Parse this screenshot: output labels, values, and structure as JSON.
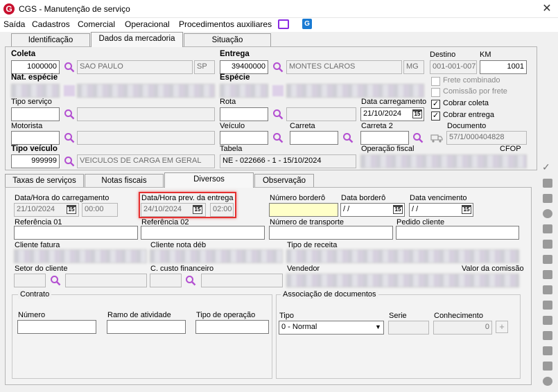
{
  "window": {
    "title": "CGS - Manutenção de serviço",
    "logo_letter": "G",
    "close": "✕"
  },
  "menu": [
    "Saída",
    "Cadastros",
    "Comercial",
    "Operacional",
    "Procedimentos auxiliares"
  ],
  "top_tabs": [
    "Identificação",
    "Dados da mercadoria",
    "Situação"
  ],
  "header": {
    "coleta_label": "Coleta",
    "coleta_value": "1000000",
    "coleta_city": "SAO PAULO",
    "coleta_uf": "SP",
    "entrega_label": "Entrega",
    "entrega_value": "39400000",
    "entrega_city": "MONTES CLAROS",
    "entrega_uf": "MG",
    "destino_label": "Destino",
    "destino_value": "001-001-007",
    "km_label": "KM",
    "km_value": "1001",
    "nat_especie_label": "Nat. espécie",
    "especie_label": "Espécie",
    "frete_combinado": "Frete combinado",
    "comissao_frete": "Comissão por frete",
    "cobrar_coleta": "Cobrar coleta",
    "cobrar_entrega": "Cobrar entrega",
    "tipo_servico_label": "Tipo serviço",
    "rota_label": "Rota",
    "data_carregamento_label": "Data carregamento",
    "data_carregamento_value": "21/10/2024",
    "motorista_label": "Motorista",
    "veiculo_label": "Veículo",
    "carreta_label": "Carreta",
    "carreta2_label": "Carreta 2",
    "documento_label": "Documento",
    "documento_value": "57/1/000404828",
    "tipo_veiculo_label": "Tipo veículo",
    "tipo_veiculo_value": "999999",
    "tipo_veiculo_desc": "VEICULOS DE CARGA EM GERAL",
    "tabela_label": "Tabela",
    "tabela_value": "NE - 022666 - 1 - 15/10/2024",
    "operacao_fiscal_label": "Operação fiscal",
    "cfop_label": "CFOP"
  },
  "sub_tabs": [
    "Taxas de serviços",
    "Notas fiscais",
    "Diversos",
    "Observação"
  ],
  "diversos": {
    "data_hora_carregamento_label": "Data/Hora do carregamento",
    "data_carregamento_value": "21/10/2024",
    "hora_carregamento_value": "00:00",
    "data_hora_prev_label": "Data/Hora prev. da entrega",
    "data_prev_value": "24/10/2024",
    "hora_prev_value": "02:00",
    "numero_bordero_label": "Número borderô",
    "data_bordero_label": "Data borderô",
    "data_bordero_value": " /  /",
    "data_vencimento_label": "Data vencimento",
    "data_vencimento_value": " /  /",
    "referencia01_label": "Referência 01",
    "referencia02_label": "Referência 02",
    "numero_transporte_label": "Número de transporte",
    "pedido_cliente_label": "Pedido cliente",
    "cliente_fatura_label": "Cliente fatura",
    "cliente_nota_deb_label": "Cliente nota déb",
    "tipo_receita_label": "Tipo de receita",
    "setor_cliente_label": "Setor do cliente",
    "custo_financeiro_label": "C. custo financeiro",
    "vendedor_label": "Vendedor",
    "valor_comissao_label": "Valor da comissão",
    "contrato_title": "Contrato",
    "numero_label": "Número",
    "ramo_label": "Ramo de atividade",
    "tipo_operacao_label": "Tipo de operação",
    "assoc_title": "Associação de documentos",
    "tipo_label": "Tipo",
    "tipo_value": "0 - Normal",
    "serie_label": "Serie",
    "conhecimento_label": "Conhecimento",
    "conhecimento_value": "0"
  },
  "colors": {
    "accent": "#c8102e",
    "search_icon": "#b34fd1",
    "highlight": "#e53030"
  }
}
